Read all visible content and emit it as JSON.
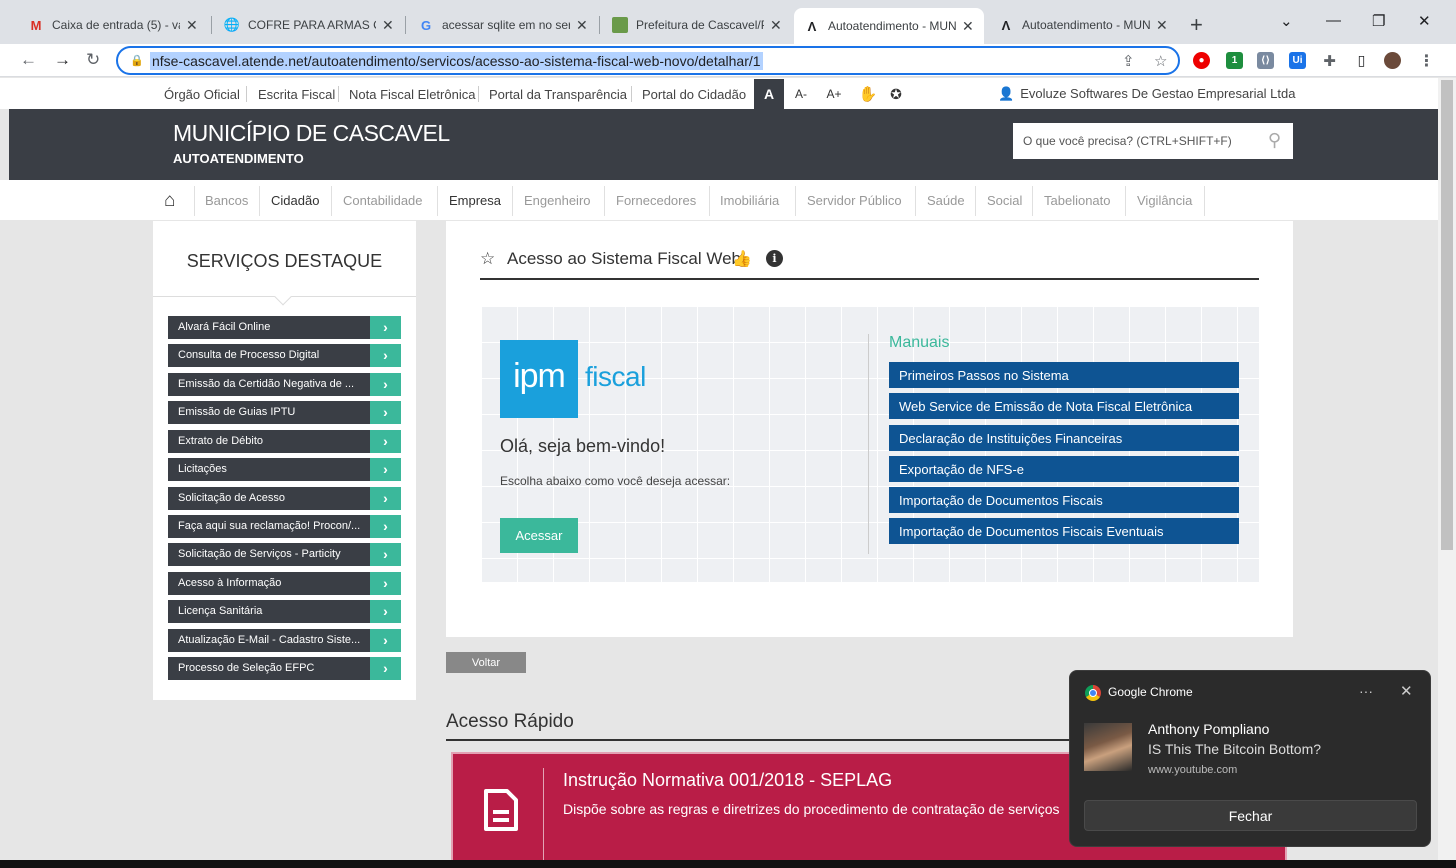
{
  "browser": {
    "tabs": [
      {
        "title": "Caixa de entrada (5) - va",
        "icon": "gmail-icon",
        "active": false
      },
      {
        "title": "COFRE PARA ARMAS CU",
        "icon": "globe-icon",
        "active": false
      },
      {
        "title": "acessar sqlite em no serv",
        "icon": "google-icon",
        "active": false
      },
      {
        "title": "Prefeitura de Cascavel/P",
        "icon": "prefeitura-icon",
        "active": false
      },
      {
        "title": "Autoatendimento - MUN",
        "icon": "atende-icon",
        "active": true
      },
      {
        "title": "Autoatendimento - MUN",
        "icon": "atende-icon",
        "active": false
      }
    ],
    "url": "nfse-cascavel.atende.net/autoatendimento/servicos/acesso-ao-sistema-fiscal-web-novo/detalhar/1"
  },
  "toplinks": {
    "items": [
      "Órgão Oficial",
      "Escrita Fiscal",
      "Nota Fiscal Eletrônica",
      "Portal da Transparência",
      "Portal do Cidadão"
    ],
    "font_normal": "A",
    "font_smaller": "A-",
    "font_larger": "A+",
    "company": "Evoluze Softwares De Gestao Empresarial Ltda"
  },
  "header": {
    "title": "MUNICÍPIO DE CASCAVEL",
    "subtitle": "AUTOATENDIMENTO",
    "search_placeholder": "O que você precisa? (CTRL+SHIFT+F)"
  },
  "categories": [
    "Bancos",
    "Cidadão",
    "Contabilidade",
    "Empresa",
    "Engenheiro",
    "Fornecedores",
    "Imobiliária",
    "Servidor Público",
    "Saúde",
    "Social",
    "Tabelionato",
    "Vigilância"
  ],
  "sidebar": {
    "title": "SERVIÇOS DESTAQUE",
    "items": [
      "Alvará Fácil Online",
      "Consulta de Processo Digital",
      "Emissão da Certidão Negativa de ...",
      "Emissão de Guias IPTU",
      "Extrato de Débito",
      "Licitações",
      "Solicitação de Acesso",
      "Faça aqui sua reclamação! Procon/...",
      "Solicitação de Serviços - Particity",
      "Acesso à Informação",
      "Licença Sanitária",
      "Atualização E-Mail - Cadastro Siste...",
      "Processo de Seleção EFPC"
    ]
  },
  "main": {
    "title": "Acesso ao Sistema Fiscal Web",
    "logo_mark": "ipm",
    "logo_word": "fiscal",
    "welcome": "Olá, seja bem-vindo!",
    "choose": "Escolha abaixo como você deseja acessar:",
    "access_button": "Acessar",
    "manuals_title": "Manuais",
    "manuals": [
      "Primeiros Passos no Sistema",
      "Web Service de Emissão de Nota Fiscal Eletrônica",
      "Declaração de Instituições Financeiras",
      "Exportação de NFS-e",
      "Importação de Documentos Fiscais",
      "Importação de Documentos Fiscais Eventuais"
    ],
    "back_button": "Voltar"
  },
  "quick_access": {
    "title": "Acesso Rápido",
    "banner_title": "Instrução Normativa 001/2018 - SEPLAG",
    "banner_desc": "Dispõe sobre as regras e diretrizes do procedimento de contratação de serviços"
  },
  "notification": {
    "app": "Google Chrome",
    "sender": "Anthony Pompliano",
    "message": "IS This The Bitcoin Bottom?",
    "source": "www.youtube.com",
    "close_button": "Fechar"
  },
  "colors": {
    "header_bg": "#3a3e45",
    "accent_green": "#3bb89b",
    "manual_blue": "#0e5493",
    "banner_red": "#b91d47",
    "ipm_blue": "#1aa0dc"
  }
}
